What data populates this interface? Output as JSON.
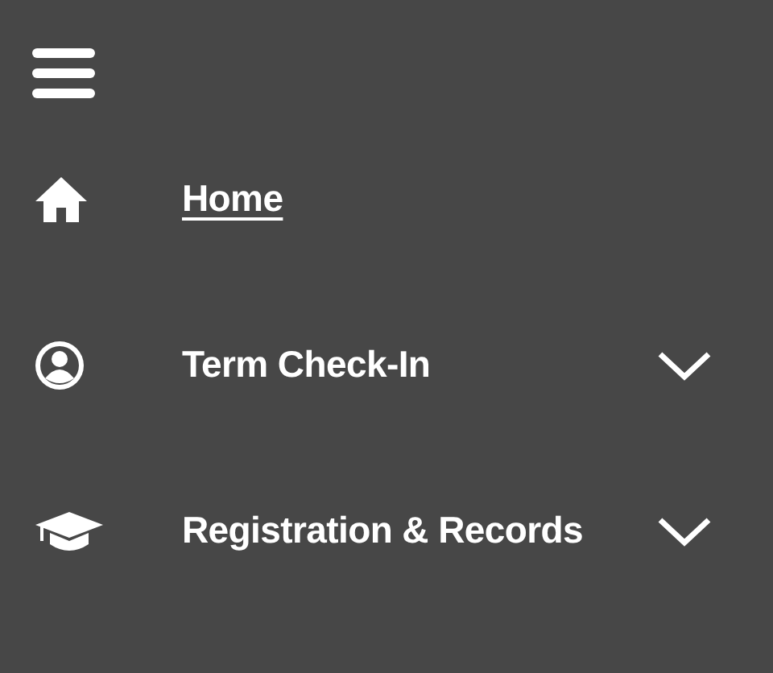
{
  "menu_button": {
    "kind": "hamburger"
  },
  "nav_items": [
    {
      "label": "Home",
      "kind": "link",
      "selected": true
    },
    {
      "label": "Term Check-In",
      "kind": "menu",
      "selected": false,
      "expanded": false
    },
    {
      "label": "Registration & Records",
      "kind": "menu",
      "selected": false,
      "expanded": false
    }
  ]
}
